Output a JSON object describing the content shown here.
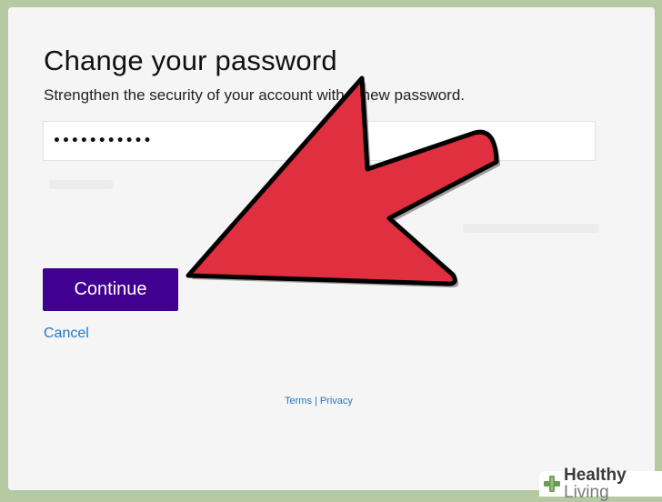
{
  "form": {
    "title": "Change your password",
    "subtitle": "Strengthen the security of your account with a new password.",
    "password_value": "•••••••••••",
    "continue_label": "Continue",
    "cancel_label": "Cancel"
  },
  "footer": {
    "terms_label": "Terms",
    "separator": "|",
    "privacy_label": "Privacy"
  },
  "watermark": {
    "brand_bold": "Healthy",
    "brand_light": " Living"
  },
  "colors": {
    "button_bg": "#400090",
    "link": "#1e78c8",
    "arrow_fill": "#e02f3e",
    "arrow_outline": "#000000",
    "watermark_cross": "#6a9a55"
  },
  "icons": {
    "arrow": "red-pointer-arrow-icon",
    "watermark": "healthy-living-cross-icon"
  }
}
